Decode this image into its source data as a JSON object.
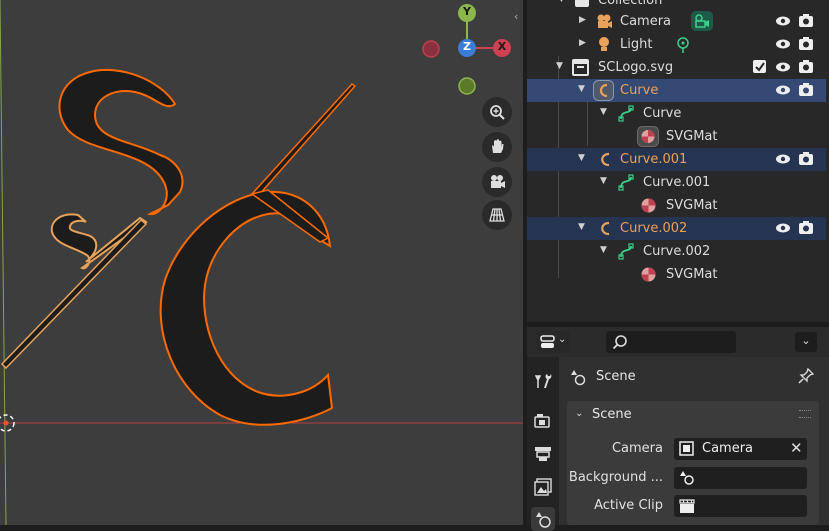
{
  "viewport": {
    "gizmo": {
      "y_label": "Y",
      "z_label": "Z",
      "x_label": "X"
    },
    "nav_icons": [
      "zoom-icon",
      "pan-hand-icon",
      "camera-view-icon",
      "grid-perspective-icon"
    ]
  },
  "outliner": {
    "rows": [
      {
        "label": "Collection"
      },
      {
        "label": "Camera"
      },
      {
        "label": "Light"
      },
      {
        "label": "SCLogo.svg"
      },
      {
        "label": "Curve"
      },
      {
        "label": "Curve"
      },
      {
        "label": "SVGMat"
      },
      {
        "label": "Curve.001"
      },
      {
        "label": "Curve.001"
      },
      {
        "label": "SVGMat"
      },
      {
        "label": "Curve.002"
      },
      {
        "label": "Curve.002"
      },
      {
        "label": "SVGMat"
      }
    ]
  },
  "properties": {
    "context_title": "Scene",
    "panel_title": "Scene",
    "camera_label": "Camera",
    "camera_value": "Camera",
    "background_label": "Background ...",
    "active_clip_label": "Active Clip"
  },
  "colors": {
    "selected_row": "#344a75",
    "selected_row_dim": "#253450",
    "curve_orange": "#e8a25a",
    "outline_orange": "#ff6a00",
    "tree_icon_green": "#3bcf8a"
  }
}
